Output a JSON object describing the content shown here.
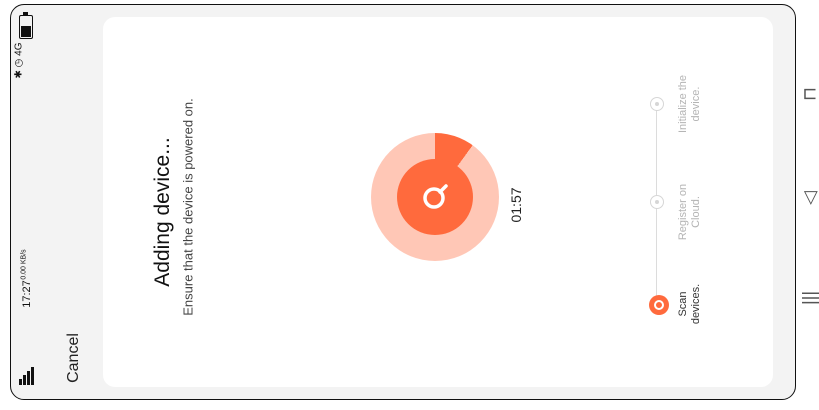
{
  "status_bar": {
    "time": "17:27",
    "speed": "0.00 KB/s",
    "network": "4G",
    "icons": [
      "bluetooth-icon",
      "alarm-icon",
      "signal-icon",
      "battery-icon"
    ]
  },
  "header": {
    "cancel_label": "Cancel"
  },
  "main": {
    "title": "Adding device...",
    "subtitle": "Ensure that the device is powered on.",
    "timer": "01:57",
    "progress": 0.1,
    "accent_color": "#ff6a3d",
    "ring_color": "#ffc7b6"
  },
  "steps": [
    {
      "label": "Scan\ndevices.",
      "state": "active"
    },
    {
      "label": "Register on\nCloud.",
      "state": "pending"
    },
    {
      "label": "Initialize the\ndevice.",
      "state": "pending"
    }
  ],
  "nav": {
    "icons": [
      "recent-apps-icon",
      "home-icon",
      "back-icon"
    ]
  }
}
